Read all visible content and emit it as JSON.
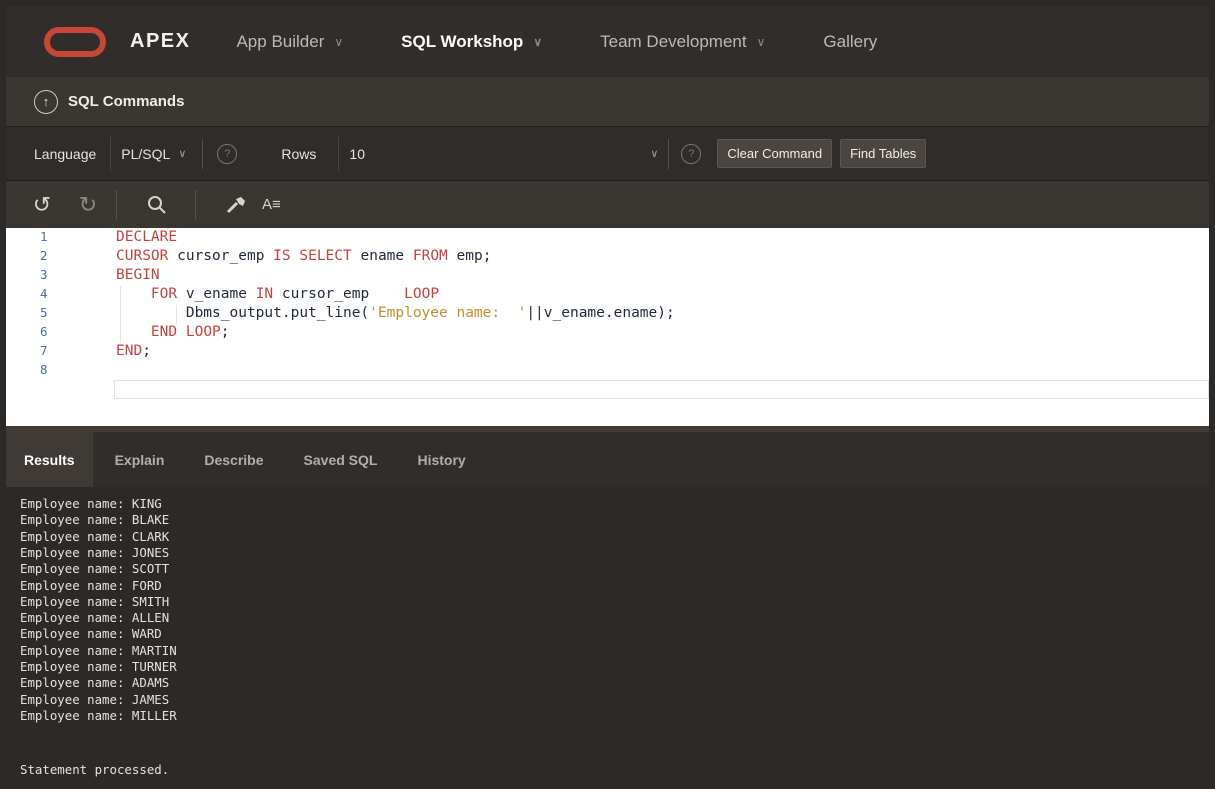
{
  "nav": {
    "brand": "APEX",
    "items": [
      {
        "label": "App Builder",
        "has_menu": true
      },
      {
        "label": "SQL Workshop",
        "has_menu": true,
        "active": true
      },
      {
        "label": "Team Development",
        "has_menu": true
      },
      {
        "label": "Gallery",
        "has_menu": false
      }
    ]
  },
  "breadcrumb": {
    "title": "SQL Commands"
  },
  "toolbar": {
    "language_label": "Language",
    "language_value": "PL/SQL",
    "rows_label": "Rows",
    "rows_value": "10",
    "clear_label": "Clear Command",
    "find_label": "Find Tables",
    "help_glyph": "?"
  },
  "editor_toolbar": {
    "undo_icon": "undo-icon",
    "redo_icon": "redo-icon",
    "search_icon": "search-icon",
    "wrench_icon": "wrench-icon",
    "az_label": "A≡"
  },
  "editor": {
    "line_numbers": [
      "1",
      "2",
      "3",
      "4",
      "5",
      "6",
      "7",
      "8"
    ],
    "lines": [
      [
        {
          "t": "DECLARE",
          "c": "kw"
        }
      ],
      [
        {
          "t": "CURSOR",
          "c": "kw"
        },
        {
          "t": " cursor_emp ",
          "c": ""
        },
        {
          "t": "IS",
          "c": "kw"
        },
        {
          "t": " ",
          "c": ""
        },
        {
          "t": "SELECT",
          "c": "kw"
        },
        {
          "t": " ename ",
          "c": ""
        },
        {
          "t": "FROM",
          "c": "kw"
        },
        {
          "t": " emp;",
          "c": ""
        }
      ],
      [
        {
          "t": "BEGIN",
          "c": "kw"
        }
      ],
      [
        {
          "t": "    ",
          "c": ""
        },
        {
          "t": "FOR",
          "c": "kw"
        },
        {
          "t": " v_ename ",
          "c": ""
        },
        {
          "t": "IN",
          "c": "kw"
        },
        {
          "t": " cursor_emp    ",
          "c": ""
        },
        {
          "t": "LOOP",
          "c": "kw"
        }
      ],
      [
        {
          "t": "        Dbms_output.put_line(",
          "c": ""
        },
        {
          "t": "'Employee name:  '",
          "c": "str"
        },
        {
          "t": "||v_ename.ename);",
          "c": ""
        }
      ],
      [
        {
          "t": "    ",
          "c": ""
        },
        {
          "t": "END",
          "c": "kw"
        },
        {
          "t": " ",
          "c": ""
        },
        {
          "t": "LOOP",
          "c": "kw"
        },
        {
          "t": ";",
          "c": ""
        }
      ],
      [
        {
          "t": "END",
          "c": "kw"
        },
        {
          "t": ";",
          "c": ""
        }
      ],
      []
    ]
  },
  "results": {
    "tabs": [
      "Results",
      "Explain",
      "Describe",
      "Saved SQL",
      "History"
    ],
    "active_tab": "Results",
    "output_lines": [
      "Employee name: KING",
      "Employee name: BLAKE",
      "Employee name: CLARK",
      "Employee name: JONES",
      "Employee name: SCOTT",
      "Employee name: FORD",
      "Employee name: SMITH",
      "Employee name: ALLEN",
      "Employee name: WARD",
      "Employee name: MARTIN",
      "Employee name: TURNER",
      "Employee name: ADAMS",
      "Employee name: JAMES",
      "Employee name: MILLER"
    ],
    "status": "Statement processed."
  },
  "colors": {
    "accent": "#c74634",
    "keyword": "#c8423c",
    "string": "#c48f2a"
  }
}
